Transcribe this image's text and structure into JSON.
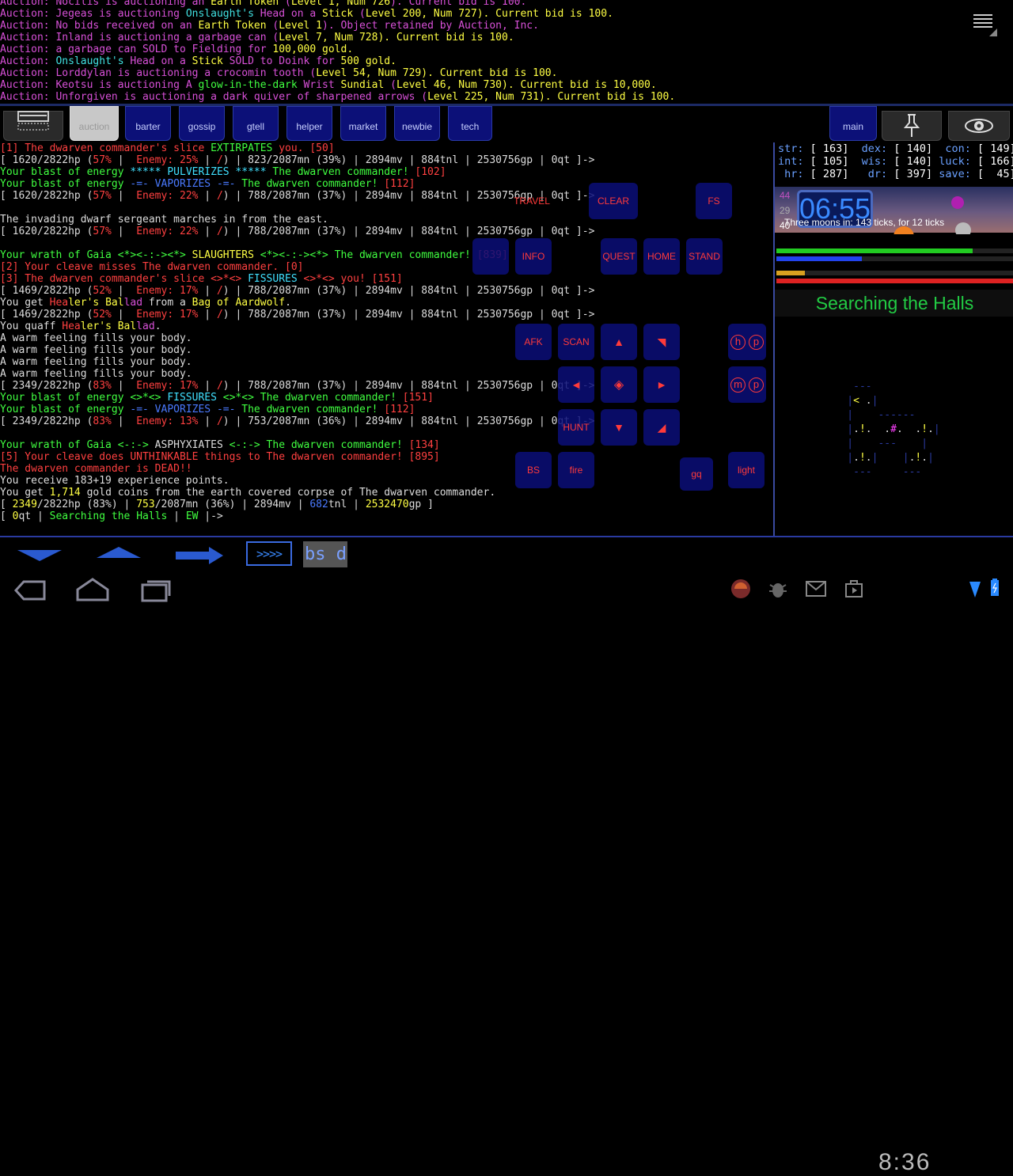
{
  "auction_lines": [
    [
      [
        "Auction: ",
        "#d850d8"
      ],
      [
        "Nocilis is auctioning an ",
        "#d850d8"
      ],
      [
        "Earth Token",
        "#ffff44"
      ],
      [
        " (",
        "#d850d8"
      ],
      [
        "Level 1, Num 726",
        "#ffff44"
      ],
      [
        "). Current bid is 100.",
        "#d850d8"
      ]
    ],
    [
      [
        "Auction: ",
        "#d850d8"
      ],
      [
        "Jegeas is auctioning ",
        "#d850d8"
      ],
      [
        "Onslaught's",
        "#40e0e0"
      ],
      [
        " Head on a ",
        "#d850d8"
      ],
      [
        "Stick",
        "#ffff44"
      ],
      [
        " (",
        "#d850d8"
      ],
      [
        "Level 200, Num 727",
        "#ffff44"
      ],
      [
        "). Current bid is 100.",
        "#ffff44"
      ]
    ],
    [
      [
        "Auction: ",
        "#d850d8"
      ],
      [
        "No bids received on an ",
        "#d850d8"
      ],
      [
        "Earth Token",
        "#ffff44"
      ],
      [
        " (",
        "#d850d8"
      ],
      [
        "Level 1",
        "#ffff44"
      ],
      [
        "). Object retained by Auction, Inc.",
        "#d850d8"
      ]
    ],
    [
      [
        "Auction: ",
        "#d850d8"
      ],
      [
        "Inland is auctioning a garbage can (",
        "#d850d8"
      ],
      [
        "Level 7, Num 728",
        "#ffff44"
      ],
      [
        "). Current bid is 100.",
        "#ffff44"
      ]
    ],
    [
      [
        "Auction: ",
        "#d850d8"
      ],
      [
        "a garbage can ",
        "#d850d8"
      ],
      [
        "SOLD to Fielding for ",
        "#d850d8"
      ],
      [
        "100,000",
        "#ffff44"
      ],
      [
        " gold.",
        "#ffff44"
      ]
    ],
    [
      [
        "Auction: ",
        "#d850d8"
      ],
      [
        "Onslaught's",
        "#40e0e0"
      ],
      [
        " Head ",
        "#d850d8"
      ],
      [
        "on a ",
        "#d850d8"
      ],
      [
        "Stick",
        "#ffff44"
      ],
      [
        " SOLD to Doink for ",
        "#d850d8"
      ],
      [
        "500",
        "#ffff44"
      ],
      [
        " gold.",
        "#ffff44"
      ]
    ],
    [
      [
        "Auction: ",
        "#d850d8"
      ],
      [
        "Lorddylan is auctioning a crocomin tooth (",
        "#d850d8"
      ],
      [
        "Level 54, Num 729",
        "#ffff44"
      ],
      [
        "). Current bid is 100.",
        "#ffff44"
      ]
    ],
    [
      [
        "Auction: ",
        "#d850d8"
      ],
      [
        "Keotsu is auctioning A ",
        "#d850d8"
      ],
      [
        "glow-in-the-dark",
        "#40ff40"
      ],
      [
        " Wrist ",
        "#d850d8"
      ],
      [
        "Sundial",
        "#ffff44"
      ],
      [
        " (",
        "#d850d8"
      ],
      [
        "Level 46, Num 730",
        "#ffff44"
      ],
      [
        "). Current bid is 10,000.",
        "#ffff44"
      ]
    ],
    [
      [
        "Auction: ",
        "#d850d8"
      ],
      [
        "Unforgiven is auctioning a dark quiver of sharpened arrows (",
        "#d850d8"
      ],
      [
        "Level 225, Num 731",
        "#ffff44"
      ],
      [
        "). Current bid is 100.",
        "#ffff44"
      ]
    ]
  ],
  "tabs": [
    {
      "label": "",
      "name": "keyboard"
    },
    {
      "label": "auction",
      "name": "auction"
    },
    {
      "label": "barter",
      "name": "barter"
    },
    {
      "label": "gossip",
      "name": "gossip"
    },
    {
      "label": "gtell",
      "name": "gtell"
    },
    {
      "label": "helper",
      "name": "helper"
    },
    {
      "label": "market",
      "name": "market"
    },
    {
      "label": "newbie",
      "name": "newbie"
    },
    {
      "label": "tech",
      "name": "tech"
    },
    {
      "label": "main",
      "name": "main"
    },
    {
      "label": "",
      "name": "pin"
    },
    {
      "label": "",
      "name": "eye"
    }
  ],
  "output_lines": [
    [
      [
        "[1] The dwarven commander's slice ",
        "#ff4040"
      ],
      [
        "EXTIRPATES",
        "#40ff40"
      ],
      [
        " you. [50]",
        "#ff4040"
      ]
    ],
    [
      [
        "[ 1620/2822hp (",
        "#ddd"
      ],
      [
        "57%",
        "#ff4040"
      ],
      [
        " |  ",
        "#ddd"
      ],
      [
        "Enemy: 25%",
        "#ff4040"
      ],
      [
        " | ",
        "#ddd"
      ],
      [
        "/",
        "#ff4040"
      ],
      [
        ") | 823/2087mn (39%) | 2894mv | 884tnl | 2530756gp | 0qt ]->",
        "#ddd"
      ]
    ],
    [
      [
        "Your blast of energy ",
        "#40ff40"
      ],
      [
        "***** PULVERIZES *****",
        "#40e0ff"
      ],
      [
        " The dwarven commander! ",
        "#40ff40"
      ],
      [
        "[102]",
        "#ff4040"
      ]
    ],
    [
      [
        "Your blast of energy ",
        "#40ff40"
      ],
      [
        "-=- VAPORIZES -=-",
        "#4a7aff"
      ],
      [
        " The dwarven commander! ",
        "#40ff40"
      ],
      [
        "[112]",
        "#ff4040"
      ]
    ],
    [
      [
        "[ 1620/2822hp (",
        "#ddd"
      ],
      [
        "57%",
        "#ff4040"
      ],
      [
        " |  ",
        "#ddd"
      ],
      [
        "Enemy: 22%",
        "#ff4040"
      ],
      [
        " | ",
        "#ddd"
      ],
      [
        "/",
        "#ff4040"
      ],
      [
        ") | 788/2087mn (37%) | 2894mv | 884tnl | 2530756gp | 0qt ]->",
        "#ddd"
      ]
    ],
    [
      [
        "",
        ""
      ]
    ],
    [
      [
        "The invading dwarf sergeant marches in from the east.",
        "#ddd"
      ]
    ],
    [
      [
        "[ 1620/2822hp (",
        "#ddd"
      ],
      [
        "57%",
        "#ff4040"
      ],
      [
        " |  ",
        "#ddd"
      ],
      [
        "Enemy: 22%",
        "#ff4040"
      ],
      [
        " | ",
        "#ddd"
      ],
      [
        "/",
        "#ff4040"
      ],
      [
        ") | 788/2087mn (37%) | 2894mv | 884tnl | 2530756gp | 0qt ]->",
        "#ddd"
      ]
    ],
    [
      [
        "",
        ""
      ]
    ],
    [
      [
        "Your wrath of Gaia <*><-:-><*> ",
        "#40ff40"
      ],
      [
        "SLAUGHTERS",
        "#ffff44"
      ],
      [
        " <*><-:-><*> The dwarven commander! ",
        "#40ff40"
      ],
      [
        "[839]",
        "#ff4040"
      ]
    ],
    [
      [
        "[2] Your cleave misses The dwarven commander. [0]",
        "#ff4040"
      ]
    ],
    [
      [
        "[3] The dwarven commander's slice <>*<> ",
        "#ff4040"
      ],
      [
        "FISSURES",
        "#40e0ff"
      ],
      [
        " <>*<> you! [151]",
        "#ff4040"
      ]
    ],
    [
      [
        "[ 1469/2822hp (",
        "#ddd"
      ],
      [
        "52%",
        "#ff4040"
      ],
      [
        " |  ",
        "#ddd"
      ],
      [
        "Enemy: 17%",
        "#ff4040"
      ],
      [
        " | ",
        "#ddd"
      ],
      [
        "/",
        "#ff4040"
      ],
      [
        ") | 788/2087mn (37%) | 2894mv | 884tnl | 2530756gp | 0qt ]->",
        "#ddd"
      ]
    ],
    [
      [
        "You get ",
        "#ddd"
      ],
      [
        "Hea",
        "#ff4040"
      ],
      [
        "ler's Bal",
        "#ffff44"
      ],
      [
        "lad",
        "#d850d8"
      ],
      [
        " from a ",
        "#ddd"
      ],
      [
        "Bag of Aardwolf",
        "#ffff44"
      ],
      [
        ".",
        "#ddd"
      ]
    ],
    [
      [
        "[ 1469/2822hp (",
        "#ddd"
      ],
      [
        "52%",
        "#ff4040"
      ],
      [
        " |  ",
        "#ddd"
      ],
      [
        "Enemy: 17%",
        "#ff4040"
      ],
      [
        " | ",
        "#ddd"
      ],
      [
        "/",
        "#ff4040"
      ],
      [
        ") | 788/2087mn (37%) | 2894mv | 884tnl | 2530756gp | 0qt ]->",
        "#ddd"
      ]
    ],
    [
      [
        "You quaff ",
        "#ddd"
      ],
      [
        "Hea",
        "#ff4040"
      ],
      [
        "ler's Bal",
        "#ffff44"
      ],
      [
        "lad",
        "#d850d8"
      ],
      [
        ".",
        "#ddd"
      ]
    ],
    [
      [
        "A warm feeling fills your body.",
        "#ddd"
      ]
    ],
    [
      [
        "A warm feeling fills your body.",
        "#ddd"
      ]
    ],
    [
      [
        "A warm feeling fills your body.",
        "#ddd"
      ]
    ],
    [
      [
        "A warm feeling fills your body.",
        "#ddd"
      ]
    ],
    [
      [
        "[ 2349/2822hp (",
        "#ddd"
      ],
      [
        "83%",
        "#ff4040"
      ],
      [
        " |  ",
        "#ddd"
      ],
      [
        "Enemy: 17%",
        "#ff4040"
      ],
      [
        " | ",
        "#ddd"
      ],
      [
        "/",
        "#ff4040"
      ],
      [
        ") | 788/2087mn (37%) | 2894mv | 884tnl | 2530756gp | 0qt ]->",
        "#ddd"
      ]
    ],
    [
      [
        "Your blast of energy <>*<> ",
        "#40ff40"
      ],
      [
        "FISSURES",
        "#40e0ff"
      ],
      [
        " <>*<> The dwarven commander! ",
        "#40ff40"
      ],
      [
        "[151]",
        "#ff4040"
      ]
    ],
    [
      [
        "Your blast of energy ",
        "#40ff40"
      ],
      [
        "-=- VAPORIZES -=-",
        "#4a7aff"
      ],
      [
        " The dwarven commander! ",
        "#40ff40"
      ],
      [
        "[112]",
        "#ff4040"
      ]
    ],
    [
      [
        "[ 2349/2822hp (",
        "#ddd"
      ],
      [
        "83%",
        "#ff4040"
      ],
      [
        " |  ",
        "#ddd"
      ],
      [
        "Enemy: 13%",
        "#ff4040"
      ],
      [
        " | ",
        "#ddd"
      ],
      [
        "/",
        "#ff4040"
      ],
      [
        ") | 753/2087mn (36%) | 2894mv | 884tnl | 2530756gp | 0qt ]->",
        "#ddd"
      ]
    ],
    [
      [
        "",
        ""
      ]
    ],
    [
      [
        "Your wrath of Gaia <-:-> ",
        "#40ff40"
      ],
      [
        "ASPHYXIATES",
        "#ddd"
      ],
      [
        " <-:-> The dwarven commander! ",
        "#40ff40"
      ],
      [
        "[134]",
        "#ff4040"
      ]
    ],
    [
      [
        "[5] Your cleave does UNTHINKABLE things to The dwarven commander! [895]",
        "#ff4040"
      ]
    ],
    [
      [
        "The dwarven commander is DEAD!!",
        "#ff4040"
      ]
    ],
    [
      [
        "You receive 183+19 experience points.",
        "#ddd"
      ]
    ],
    [
      [
        "You get ",
        "#ddd"
      ],
      [
        "1,714",
        "#ffff44"
      ],
      [
        " gold coins from the earth covered corpse of The dwarven commander.",
        "#ddd"
      ]
    ],
    [
      [
        "[ ",
        "#ddd"
      ],
      [
        "2349",
        "#ffff44"
      ],
      [
        "/2822hp (83%) | ",
        "#ddd"
      ],
      [
        "753",
        "#ffff44"
      ],
      [
        "/2087mn (36%) | 2894mv | ",
        "#ddd"
      ],
      [
        "682",
        "#4a7aff"
      ],
      [
        "tnl | ",
        "#ddd"
      ],
      [
        "2532470",
        "#ffff44"
      ],
      [
        "gp ]",
        "#ddd"
      ]
    ],
    [
      [
        "[ ",
        "#ddd"
      ],
      [
        "0",
        "#ffff44"
      ],
      [
        "qt | ",
        "#ddd"
      ],
      [
        "Searching the Halls",
        "#40ff40"
      ],
      [
        " | ",
        "#ddd"
      ],
      [
        "EW",
        "#40ff40"
      ],
      [
        " |-> ",
        "#ddd"
      ]
    ]
  ],
  "stats": [
    [
      [
        "str: ",
        "#6aa0ff"
      ],
      [
        "[ 163]",
        "#fff"
      ],
      [
        "  dex: ",
        "#6aa0ff"
      ],
      [
        "[ 140]",
        "#fff"
      ],
      [
        "  con: ",
        "#6aa0ff"
      ],
      [
        "[ 149]",
        "#fff"
      ]
    ],
    [
      [
        "int: ",
        "#6aa0ff"
      ],
      [
        "[ 105]",
        "#fff"
      ],
      [
        "  wis: ",
        "#6aa0ff"
      ],
      [
        "[ 140]",
        "#fff"
      ],
      [
        " luck: ",
        "#6aa0ff"
      ],
      [
        "[ 166]",
        "#fff"
      ]
    ],
    [
      [
        " hr: ",
        "#6aa0ff"
      ],
      [
        "[ 287]",
        "#fff"
      ],
      [
        "   dr: ",
        "#6aa0ff"
      ],
      [
        "[ 397]",
        "#fff"
      ],
      [
        " save: ",
        "#6aa0ff"
      ],
      [
        "[  45]",
        "#fff"
      ]
    ]
  ],
  "moon_panel": {
    "time": "06:55",
    "n1": "44",
    "n2": "29",
    "n3": "40",
    "text": "Three moons in: 143 ticks, for 12 ticks"
  },
  "bars": [
    {
      "name": "hp",
      "fraction": 0.83,
      "color": "#22cc22"
    },
    {
      "name": "mana",
      "fraction": 0.36,
      "color": "#2244ee"
    },
    {
      "name": "moves",
      "fraction": 0.12,
      "color": "#d8a020"
    },
    {
      "name": "enemy",
      "fraction": 1.0,
      "color": "#dd2222"
    }
  ],
  "room_title": "Searching the Halls",
  "map_lines": [
    [
      [
        "     ---",
        "#2a3aa0"
      ]
    ],
    [
      [
        "    |",
        "#2a3aa0"
      ],
      [
        "<",
        "#ffff44"
      ],
      [
        " .",
        "#ddd"
      ],
      [
        "|",
        "#2a3aa0"
      ]
    ],
    [
      [
        "    |",
        "#2a3aa0"
      ],
      [
        "    ------",
        "#2a3aa0"
      ]
    ],
    [
      [
        "    |",
        "#2a3aa0"
      ],
      [
        ".",
        "#ddd"
      ],
      [
        "!",
        "#ffff44"
      ],
      [
        ".  .",
        "#ddd"
      ],
      [
        "#",
        "#ff40ff"
      ],
      [
        ".  .",
        "#ddd"
      ],
      [
        "!",
        "#ffff44"
      ],
      [
        ".",
        "#ddd"
      ],
      [
        "|",
        "#2a3aa0"
      ]
    ],
    [
      [
        "    |",
        "#2a3aa0"
      ],
      [
        "    ---",
        "#2a3aa0"
      ],
      [
        "    |",
        "#2a3aa0"
      ]
    ],
    [
      [
        "    |",
        "#2a3aa0"
      ],
      [
        ".",
        "#ddd"
      ],
      [
        "!",
        "#ffff44"
      ],
      [
        ".",
        "#ddd"
      ],
      [
        "|",
        "#2a3aa0"
      ],
      [
        "    |",
        "#2a3aa0"
      ],
      [
        ".",
        "#ddd"
      ],
      [
        "!",
        "#ffff44"
      ],
      [
        ".",
        "#ddd"
      ],
      [
        "|",
        "#2a3aa0"
      ]
    ],
    [
      [
        "     ---     ---",
        "#2a3aa0"
      ]
    ]
  ],
  "overlay_buttons": {
    "travel": "TRAVEL",
    "clear": "CLEAR",
    "fs": "FS",
    "c1": "c1",
    "info": "INFO",
    "quest": "QUEST",
    "home": "HOME",
    "stand": "STAND",
    "afk": "AFK",
    "scan": "SCAN",
    "up": "▲",
    "upright": "◥",
    "h": "h",
    "p": "p",
    "left": "◄",
    "center": "◈",
    "right": "►",
    "m": "m",
    "p2": "p",
    "hunt": "HUNT",
    "down": "▼",
    "downright": "◢",
    "bs": "BS",
    "fire": "fire",
    "gq": "gq",
    "light": "light"
  },
  "input": {
    "value": "bs d"
  },
  "system_clock": "8:36"
}
